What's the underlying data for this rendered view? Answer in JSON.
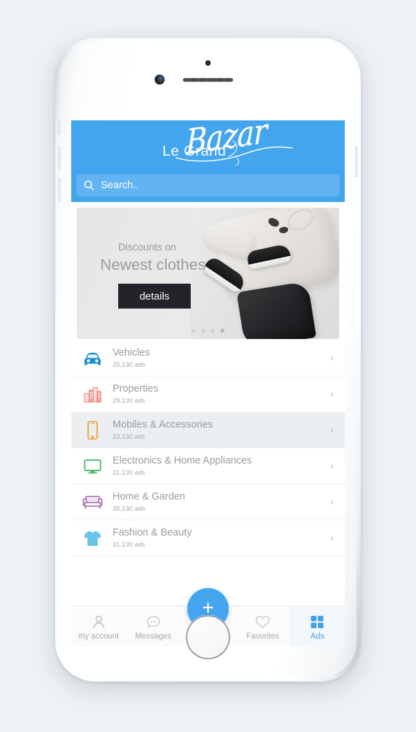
{
  "app": {
    "logo_primary": "Le Grand",
    "logo_script": "Bazar"
  },
  "search": {
    "placeholder": "Search..",
    "value": "",
    "icon": "search-icon"
  },
  "banner": {
    "subtitle": "Discounts on",
    "title": "Newest clothes",
    "cta_label": "details",
    "dots_total": 4,
    "dot_active_index": 3
  },
  "categories": [
    {
      "name": "Vehicles",
      "count": "25,130 ads",
      "icon": "car-icon",
      "color": "#2196d6",
      "highlighted": false
    },
    {
      "name": "Properties",
      "count": "29,130 ads",
      "icon": "buildings-icon",
      "color": "#f08a7e",
      "highlighted": false
    },
    {
      "name": "Mobiles & Accessories",
      "count": "23,130 ads",
      "icon": "phone-icon",
      "color": "#f0a030",
      "highlighted": true
    },
    {
      "name": "Electronics & Home Appliances",
      "count": "21,130 ads",
      "icon": "monitor-icon",
      "color": "#4cb96b",
      "highlighted": false
    },
    {
      "name": "Home & Garden",
      "count": "35,130 ads",
      "icon": "sofa-icon",
      "color": "#9b5fa8",
      "highlighted": false
    },
    {
      "name": "Fashion & Beauty",
      "count": "31,130 ads",
      "icon": "tshirt-icon",
      "color": "#6cc4e8",
      "highlighted": false
    }
  ],
  "chevron": "›",
  "bottom_nav": {
    "items": [
      {
        "label": "my account",
        "icon": "person-icon",
        "active": false
      },
      {
        "label": "Messages",
        "icon": "chat-icon",
        "active": false
      },
      {
        "label": "Favorites",
        "icon": "heart-icon",
        "active": false
      },
      {
        "label": "Ads",
        "icon": "grid-icon",
        "active": true
      }
    ],
    "fab_label": "+"
  },
  "colors": {
    "brand_blue": "#44a5ef",
    "page_background": "#eef2f5",
    "cta_dark": "#232329",
    "row_highlight": "#eceff1",
    "muted_text": "#9a9a9a"
  }
}
